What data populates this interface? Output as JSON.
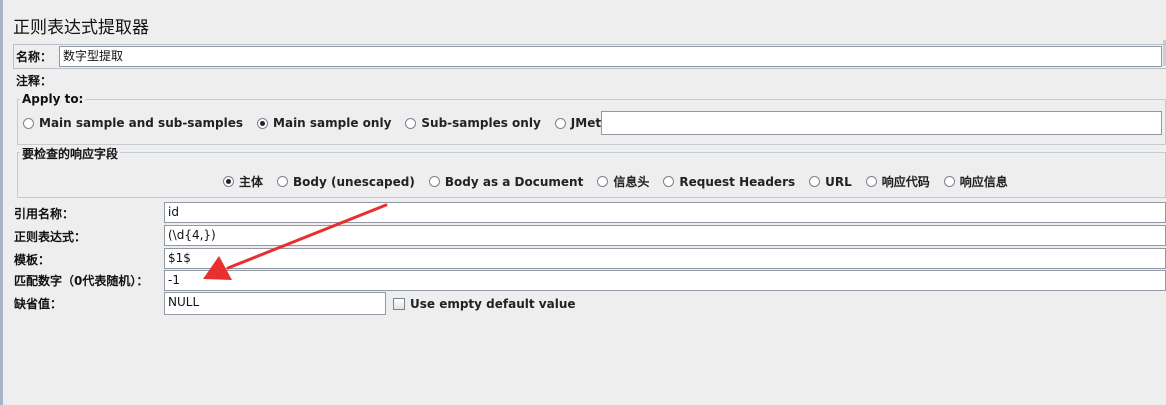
{
  "title": "正则表达式提取器",
  "name": {
    "label": "名称：",
    "value": "数字型提取"
  },
  "comment": {
    "label": "注释：",
    "value": ""
  },
  "apply_to": {
    "legend": "Apply to:",
    "options": [
      "Main sample and sub-samples",
      "Main sample only",
      "Sub-samples only",
      "JMeter Variable"
    ],
    "selected": "Main sample only",
    "variable_value": ""
  },
  "field_to_check": {
    "legend": "要检查的响应字段",
    "options": [
      "主体",
      "Body (unescaped)",
      "Body as a Document",
      "信息头",
      "Request Headers",
      "URL",
      "响应代码",
      "响应信息"
    ],
    "selected": "主体"
  },
  "form": {
    "ref_name": {
      "label": "引用名称：",
      "value": "id"
    },
    "regex": {
      "label": "正则表达式：",
      "value": "(\\d{4,})"
    },
    "template": {
      "label": "模板：",
      "value": "$1$"
    },
    "match_no": {
      "label": "匹配数字（0代表随机）：",
      "value": "-1"
    },
    "default": {
      "label": "缺省值：",
      "value": "NULL",
      "checkbox_label": "Use empty default value",
      "checkbox_checked": false
    }
  },
  "annotation": {
    "arrow_color": "#e8312f"
  }
}
